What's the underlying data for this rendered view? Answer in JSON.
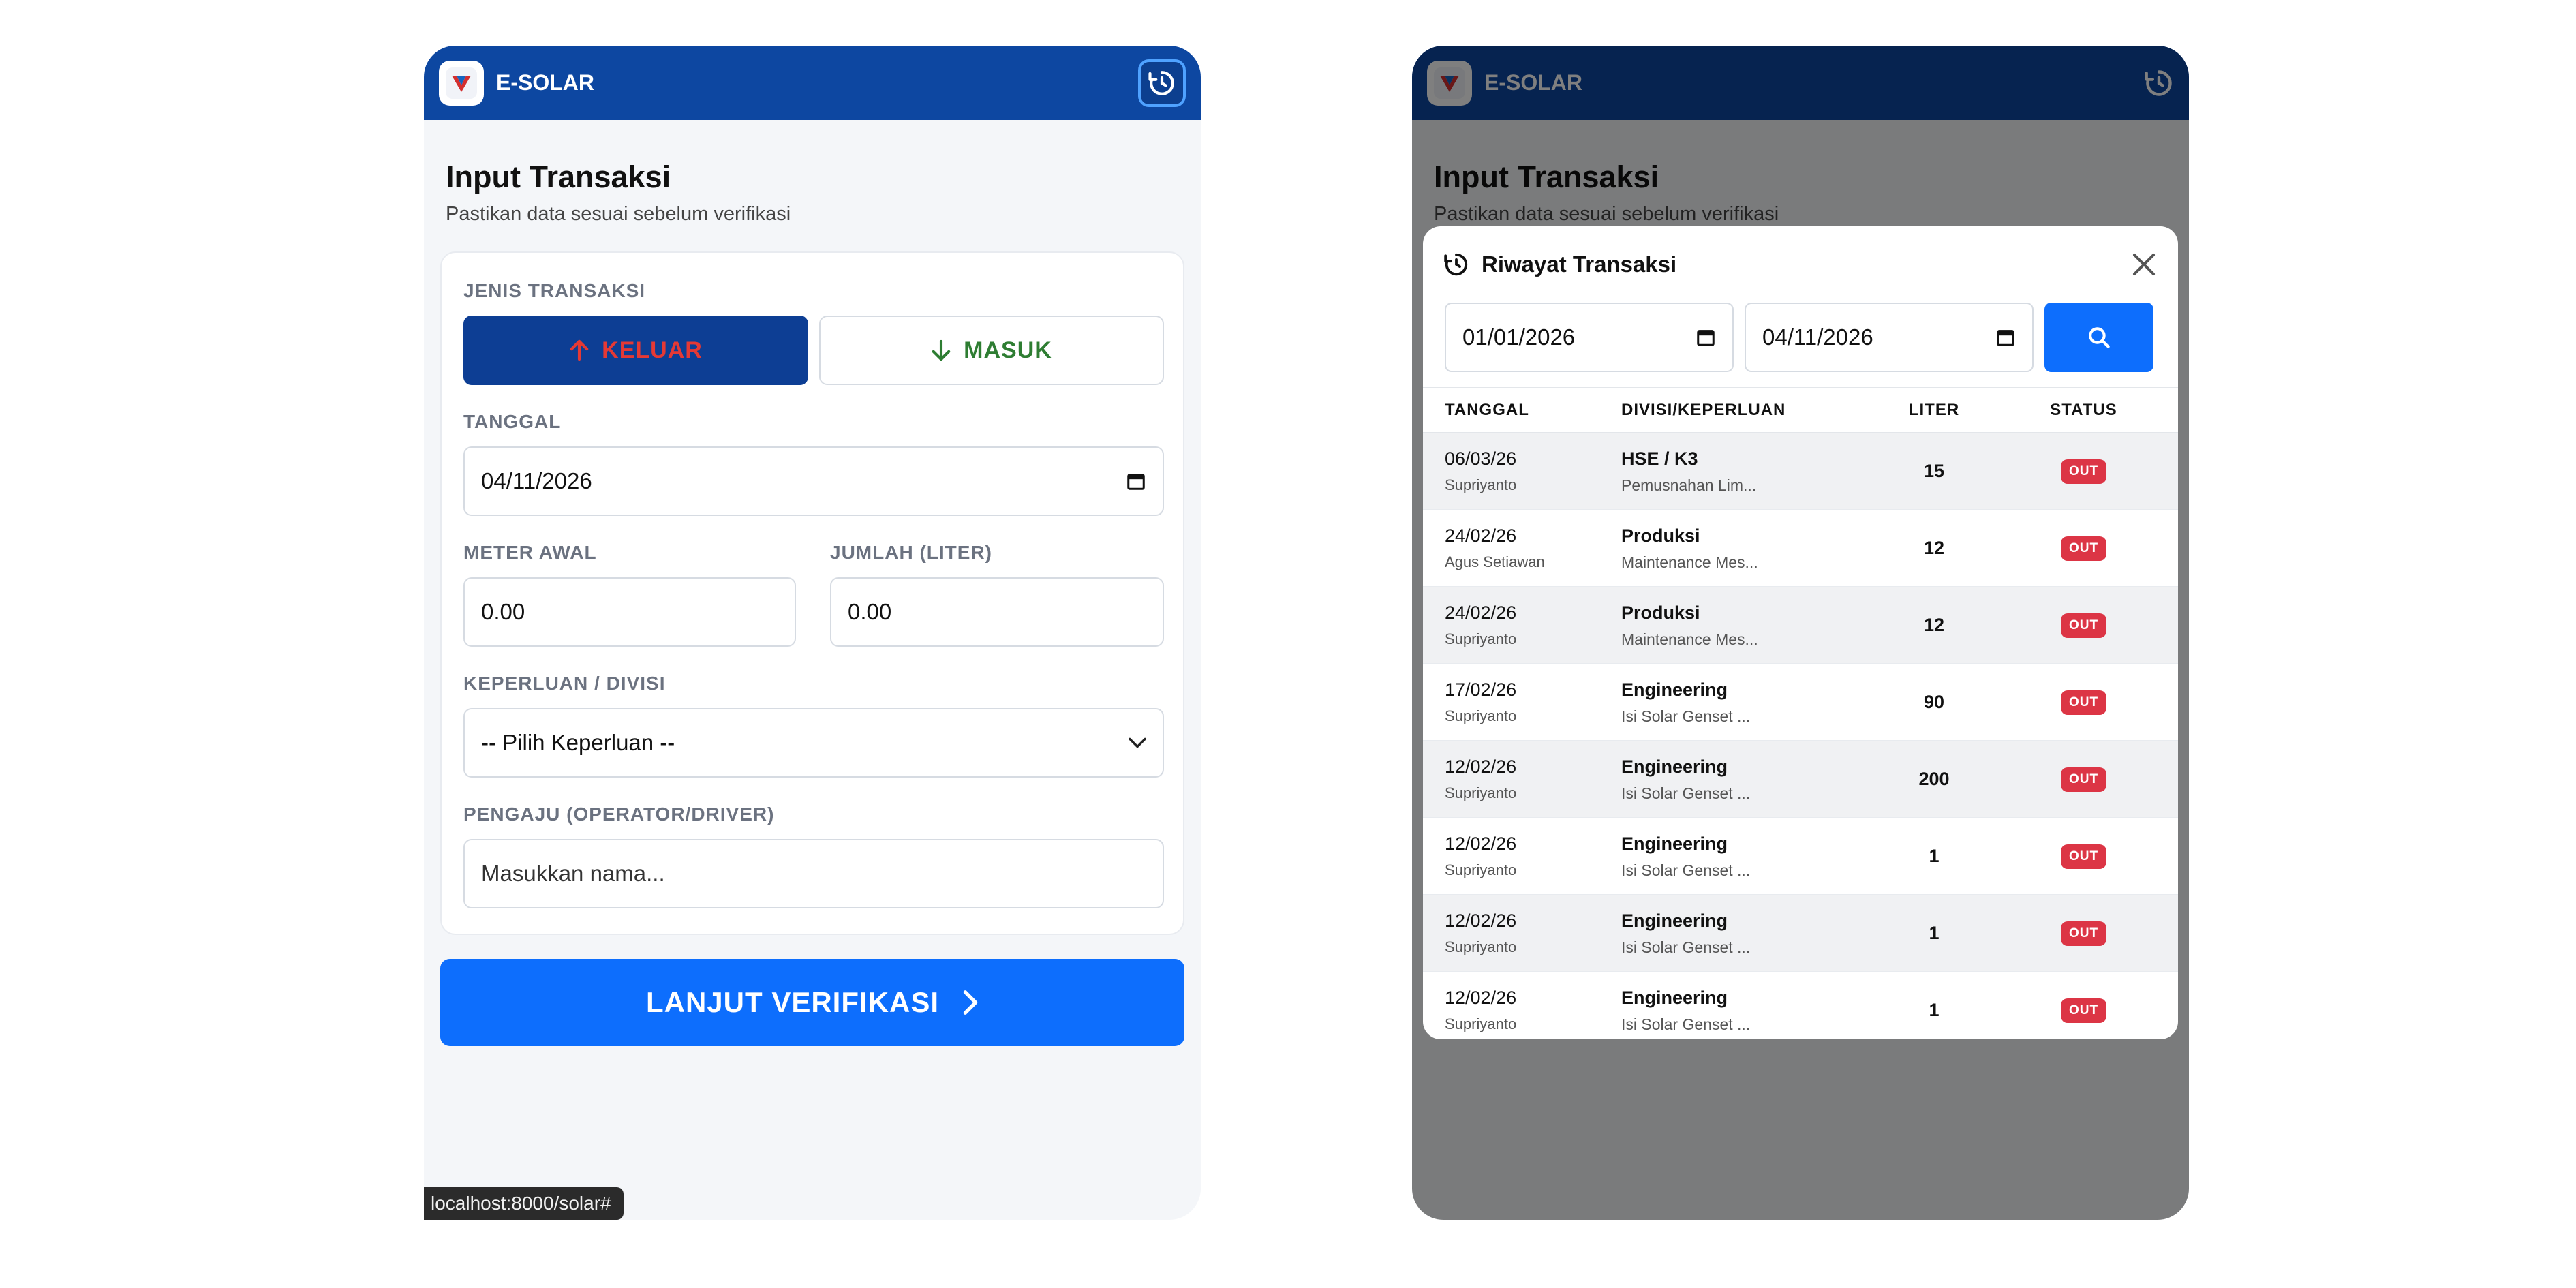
{
  "app": {
    "brand": "E-SOLAR"
  },
  "form": {
    "title": "Input Transaksi",
    "subtitle": "Pastikan data sesuai sebelum verifikasi",
    "type_label": "JENIS TRANSAKSI",
    "type_out": "KELUAR",
    "type_in": "MASUK",
    "date_label": "TANGGAL",
    "date_value": "04/11/2026",
    "meter_label": "METER AWAL",
    "meter_value": "0.00",
    "amount_label": "JUMLAH (LITER)",
    "amount_value": "0.00",
    "purpose_label": "KEPERLUAN / DIVISI",
    "purpose_value": "-- Pilih Keperluan --",
    "requester_label": "PENGAJU (OPERATOR/DRIVER)",
    "requester_placeholder": "Masukkan nama...",
    "submit_label": "LANJUT VERIFIKASI"
  },
  "status_bar": {
    "url": "localhost:8000/solar#"
  },
  "history": {
    "title": "Riwayat Transaksi",
    "date_from": "01/01/2026",
    "date_to": "04/11/2026",
    "columns": [
      "TANGGAL",
      "DIVISI/KEPERLUAN",
      "LITER",
      "STATUS"
    ],
    "rows": [
      {
        "date": "06/03/26",
        "person": "Supriyanto",
        "division": "HSE / K3",
        "purpose": "Pemusnahan Lim...",
        "liter": "15",
        "status": "OUT"
      },
      {
        "date": "24/02/26",
        "person": "Agus Setiawan",
        "division": "Produksi",
        "purpose": "Maintenance Mes...",
        "liter": "12",
        "status": "OUT"
      },
      {
        "date": "24/02/26",
        "person": "Supriyanto",
        "division": "Produksi",
        "purpose": "Maintenance Mes...",
        "liter": "12",
        "status": "OUT"
      },
      {
        "date": "17/02/26",
        "person": "Supriyanto",
        "division": "Engineering",
        "purpose": "Isi Solar Genset ...",
        "liter": "90",
        "status": "OUT"
      },
      {
        "date": "12/02/26",
        "person": "Supriyanto",
        "division": "Engineering",
        "purpose": "Isi Solar Genset ...",
        "liter": "200",
        "status": "OUT"
      },
      {
        "date": "12/02/26",
        "person": "Supriyanto",
        "division": "Engineering",
        "purpose": "Isi Solar Genset ...",
        "liter": "1",
        "status": "OUT"
      },
      {
        "date": "12/02/26",
        "person": "Supriyanto",
        "division": "Engineering",
        "purpose": "Isi Solar Genset ...",
        "liter": "1",
        "status": "OUT"
      },
      {
        "date": "12/02/26",
        "person": "Supriyanto",
        "division": "Engineering",
        "purpose": "Isi Solar Genset ...",
        "liter": "1",
        "status": "OUT"
      }
    ]
  },
  "colors": {
    "primary": "#0d47a1",
    "accent": "#0d6efd",
    "danger": "#dc3545",
    "success": "#2e7d32"
  }
}
